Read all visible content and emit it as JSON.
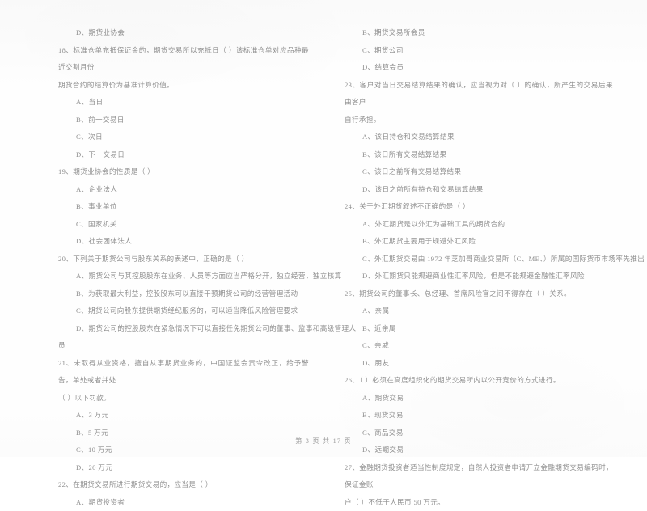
{
  "document": {
    "type": "scanned-exam-paper",
    "language": "zh-CN",
    "footer": "第 3 页 共 17 页"
  },
  "left_column": {
    "blocks": [
      {
        "kind": "option",
        "text": "D、期货业协会"
      },
      {
        "kind": "stem",
        "text": "18、标准仓单充抵保证金的，期货交易所以充抵日（      ）该标准仓单对应品种最近交割月份"
      },
      {
        "kind": "cont",
        "text": "期货合约的结算价为基准计算价值。"
      },
      {
        "kind": "option",
        "text": "A、当日"
      },
      {
        "kind": "option",
        "text": "B、前一交易日"
      },
      {
        "kind": "option",
        "text": "C、次日"
      },
      {
        "kind": "option",
        "text": "D、下一交易日"
      },
      {
        "kind": "stem",
        "text": "19、期货业协会的性质是（      ）"
      },
      {
        "kind": "option",
        "text": "A、企业法人"
      },
      {
        "kind": "option",
        "text": "B、事业单位"
      },
      {
        "kind": "option",
        "text": "C、国家机关"
      },
      {
        "kind": "option",
        "text": "D、社会团体法人"
      },
      {
        "kind": "stem",
        "text": "20、下列关于期货公司与股东关系的表述中，正确的是（      ）"
      },
      {
        "kind": "option",
        "text": "A、期货公司与其控股股东在业务、人员等方面应当严格分开，独立经营，独立核算"
      },
      {
        "kind": "option",
        "text": "B、为获取最大利益，控股股东可以直接干预期货公司的经营管理活动"
      },
      {
        "kind": "option",
        "text": "C、期货公司向股东提供期货经纪服务的，可以适当降低风险管理要求"
      },
      {
        "kind": "option",
        "text": "D、期货公司的控股股东在紧急情况下可以直接任免期货公司的董事、监事和高级管理人"
      },
      {
        "kind": "cont",
        "text": "员"
      },
      {
        "kind": "stem",
        "text": "21、未取得从业资格，擅自从事期货业务的，中国证监会责令改正，给予警告，单处或者并处"
      },
      {
        "kind": "cont",
        "text": "（      ）以下罚款。"
      },
      {
        "kind": "option",
        "text": "A、3 万元"
      },
      {
        "kind": "option",
        "text": "B、5 万元"
      },
      {
        "kind": "option",
        "text": "C、10 万元"
      },
      {
        "kind": "option",
        "text": "D、20 万元"
      },
      {
        "kind": "stem",
        "text": "22、在期货交易所进行期货交易的，应当是（      ）"
      },
      {
        "kind": "option",
        "text": "A、期货投资者"
      }
    ]
  },
  "right_column": {
    "blocks": [
      {
        "kind": "option",
        "text": "B、期货交易所会员"
      },
      {
        "kind": "option",
        "text": "C、期货公司"
      },
      {
        "kind": "option",
        "text": "D、结算会员"
      },
      {
        "kind": "stem",
        "text": "23、客户对当日交易结算结果的确认，应当视为对（      ）的确认，所产生的交易后果由客户"
      },
      {
        "kind": "cont",
        "text": "自行承担。"
      },
      {
        "kind": "option",
        "text": "A、该日持仓和交易结算结果"
      },
      {
        "kind": "option",
        "text": "B、该日所有交易结算结果"
      },
      {
        "kind": "option",
        "text": "C、该日之前所有交易结算结果"
      },
      {
        "kind": "option",
        "text": "D、该日之前所有持仓和交易结算结果"
      },
      {
        "kind": "stem",
        "text": "24、关于外汇期货叙述不正确的是（      ）"
      },
      {
        "kind": "option",
        "text": "A、外汇期货是以外汇为基础工具的期货合约"
      },
      {
        "kind": "option",
        "text": "B、外汇期货主要用于规避外汇风险"
      },
      {
        "kind": "option",
        "text": "C、外汇期货交易由 1972 年芝加哥商业交易所（C、ME、）所属的国际货币市场率先推出"
      },
      {
        "kind": "option",
        "text": "D、外汇期货只能规避商业性汇率风险，但是不能规避金融性汇率风险"
      },
      {
        "kind": "stem",
        "text": "25、期货公司的董事长、总经理、首席风险官之间不得存在（      ）关系。"
      },
      {
        "kind": "option",
        "text": "A、亲属"
      },
      {
        "kind": "option",
        "text": "B、近亲属"
      },
      {
        "kind": "option",
        "text": "C、亲戚"
      },
      {
        "kind": "option",
        "text": "D、朋友"
      },
      {
        "kind": "stem",
        "text": "26、（      ）必须在高度组织化的期货交易所内以公开竞价的方式进行。"
      },
      {
        "kind": "option",
        "text": "A、期货交易"
      },
      {
        "kind": "option",
        "text": "B、现货交易"
      },
      {
        "kind": "option",
        "text": "C、商品交易"
      },
      {
        "kind": "option",
        "text": "D、远期交易"
      },
      {
        "kind": "stem",
        "text": "27、金融期货投资者适当性制度规定，自然人投资者申请开立金融期货交易编码时，保证金账"
      },
      {
        "kind": "cont",
        "text": "户（      ）不低于人民币 50 万元。"
      }
    ]
  }
}
